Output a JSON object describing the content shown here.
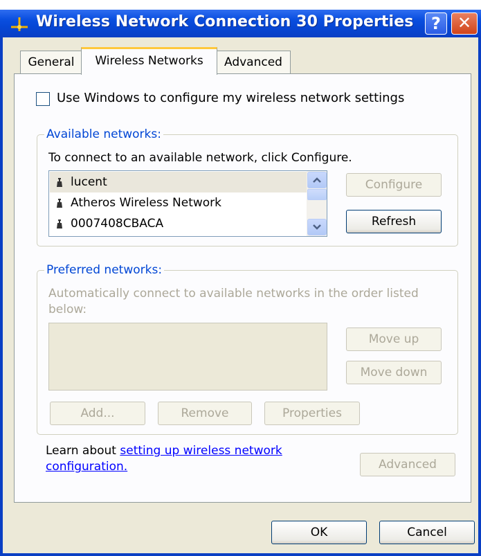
{
  "window": {
    "title": "Wireless Network Connection 30 Properties",
    "help_label": "?",
    "close_label": "✕"
  },
  "tabs": [
    {
      "label": "General",
      "active": false
    },
    {
      "label": "Wireless Networks",
      "active": true
    },
    {
      "label": "Advanced",
      "active": false
    }
  ],
  "wireless": {
    "use_windows_label": "Use Windows to configure my wireless network settings",
    "use_windows_checked": false,
    "available": {
      "title": "Available networks:",
      "instruction": "To connect to an available network, click Configure.",
      "networks": [
        "lucent",
        "Atheros Wireless Network",
        "0007408CBACA"
      ],
      "selected_index": 0,
      "configure_label": "Configure",
      "refresh_label": "Refresh"
    },
    "preferred": {
      "title": "Preferred networks:",
      "instruction_line1": "Automatically connect to available networks in the order listed",
      "instruction_line2": "below:",
      "move_up_label": "Move up",
      "move_down_label": "Move down",
      "add_label": "Add...",
      "remove_label": "Remove",
      "properties_label": "Properties"
    },
    "learn_prefix": "Learn about ",
    "learn_link_line1": "setting up wireless network",
    "learn_link_line2": "configuration.",
    "advanced_label": "Advanced"
  },
  "footer": {
    "ok_label": "OK",
    "cancel_label": "Cancel"
  },
  "colors": {
    "titlebar": "#0a4fe0",
    "group_title": "#0046d5",
    "link": "#0000ff",
    "disabled": "#aca899"
  }
}
